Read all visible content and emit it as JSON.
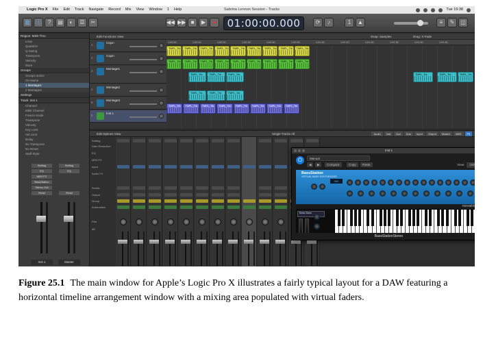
{
  "menubar": {
    "app": "Logic Pro X",
    "items": [
      "File",
      "Edit",
      "Track",
      "Navigate",
      "Record",
      "Mix",
      "View",
      "Window",
      "1",
      "Help"
    ],
    "window_title": "Sabrina Lennon Session - Tracks",
    "clock": "Tue 19:38"
  },
  "controlbar": {
    "lcd": "01:00:00.000",
    "buttons": [
      "library",
      "inspector",
      "help",
      "toolbar",
      "smart-controls",
      "mixer",
      "editors"
    ],
    "transport": [
      "rewind",
      "fast-forward",
      "stop",
      "play",
      "record"
    ]
  },
  "inspector": {
    "region_header": "Region: MIDI Thru",
    "region_rows": [
      "Loop",
      "Quantize",
      "Q-Swing",
      "Transpose",
      "Velocity",
      "More"
    ],
    "groups_header": "Groups",
    "groups_rows": [
      "Groups active",
      "On  Name",
      "1  Montage1",
      "2  Montage2"
    ],
    "settings_header": "Settings",
    "track_header": "Track:  Inst 1",
    "track_rows": [
      "Channel",
      "MIDI Channel",
      "Freeze Mode",
      "Transpose",
      "Velocity",
      "Key Limit",
      "Vel Limit",
      "Delay",
      "No Transpose",
      "No Reset",
      "Staff Style"
    ],
    "strips": [
      {
        "name": "Inst 1",
        "slots": [
          "Setting",
          "EQ",
          "MIDI FX",
          "BassStation",
          "Audio FX",
          "Sends",
          "Stereo Out",
          "Read"
        ]
      },
      {
        "name": "Master",
        "slots": [
          "Setting",
          "EQ",
          "",
          "",
          "",
          "",
          "",
          "Read"
        ]
      }
    ]
  },
  "tracks": {
    "toolbar": "Edit  Functions  View",
    "snap": "Snap: Samples",
    "drag": "Drag: X-Fade",
    "headers": [
      {
        "num": "1",
        "name": "Cajon"
      },
      {
        "num": "2",
        "name": "Cajon"
      },
      {
        "num": "3",
        "name": "Montage1"
      },
      {
        "num": "4",
        "name": "Montage2"
      },
      {
        "num": "5",
        "name": "Montage3"
      },
      {
        "num": "6",
        "name": "Inst 1"
      }
    ],
    "ruler": [
      "1:00:00",
      "1:00:10",
      "1:00:20",
      "1:00:30",
      "1:00:40",
      "1:00:50",
      "1:01:00",
      "1:01:10",
      "1:01:20",
      "1:01:30",
      "1:01:40",
      "1:01:50"
    ],
    "region_label": "TMPL_Trk"
  },
  "mixer": {
    "toolbar": "Edit  Options  View",
    "single_tracks": "Single  Tracks  All",
    "tabs": [
      "Audio",
      "Inst",
      "Aux",
      "Bus",
      "Input",
      "Output",
      "Master",
      "MIDI",
      "Fit"
    ],
    "active_tab": "Fit",
    "row_labels": [
      "Setting",
      "Gain Reduction",
      "EQ",
      "MIDI FX",
      "Input",
      "Audio FX",
      "Sends",
      "Output",
      "Group",
      "Automation",
      "",
      "Pan",
      "dB"
    ],
    "strip_count": 13,
    "selected_strip": 8
  },
  "plugin": {
    "title": "Inst 1",
    "preset": "Manual",
    "buttons": [
      "Compare",
      "Copy",
      "Paste"
    ],
    "view_label": "View:",
    "view_value": "100%",
    "synth_name": "BassStation",
    "synth_sub": "VIRTUAL BASS SYNTHESIZER",
    "lcd": "000",
    "brand": "novation",
    "patch": "Bass Bass",
    "footer": "BassStationStereo"
  },
  "caption": {
    "label": "Figure 25.1",
    "text": "The main window for Apple’s Logic Pro X illustrates a fairly typical layout for a DAW featuring a horizontal timeline arrangement window with a mixing area populated with virtual faders."
  },
  "colors": {
    "yellow_region": "#d6d64a",
    "green_region": "#59c23d",
    "teal_region": "#3fbdc8",
    "purple_region": "#6d6fd6",
    "synth_blue": "#1f7fc8",
    "accent_blue": "#3476c4"
  }
}
